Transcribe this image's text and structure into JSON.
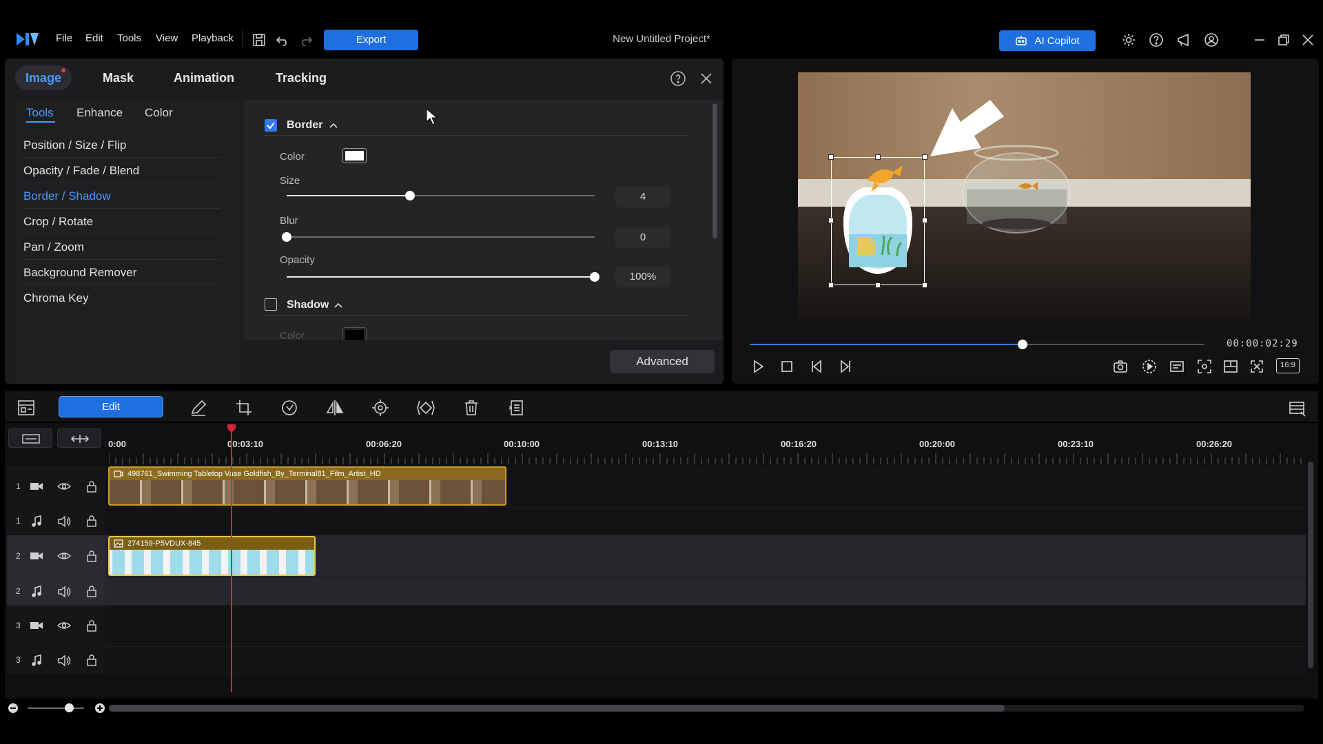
{
  "menubar": {
    "items": [
      "File",
      "Edit",
      "Tools",
      "View",
      "Playback"
    ],
    "export_label": "Export",
    "project_title": "New Untitled Project*",
    "copilot_label": "AI Copilot"
  },
  "panel": {
    "tabs": [
      "Image",
      "Mask",
      "Animation",
      "Tracking"
    ],
    "active_tab": "Image",
    "subtabs": [
      "Tools",
      "Enhance",
      "Color"
    ],
    "active_subtab": "Tools",
    "sidebar_items": [
      "Position / Size / Flip",
      "Opacity / Fade / Blend",
      "Border / Shadow",
      "Crop / Rotate",
      "Pan / Zoom",
      "Background Remover",
      "Chroma Key"
    ],
    "active_sidebar_item": "Border / Shadow",
    "border": {
      "title": "Border",
      "checked": true,
      "color_label": "Color",
      "color_value": "#ffffff",
      "size_label": "Size",
      "size_value": "4",
      "size_fraction": 0.4,
      "blur_label": "Blur",
      "blur_value": "0",
      "blur_fraction": 0.0,
      "opacity_label": "Opacity",
      "opacity_value": "100%",
      "opacity_fraction": 1.0
    },
    "shadow": {
      "title": "Shadow",
      "checked": false,
      "color_label": "Color",
      "color_value": "#000000"
    },
    "advanced_label": "Advanced"
  },
  "preview": {
    "timecode": "00:00:02:29",
    "progress_fraction": 0.6,
    "aspect_label": "16:9"
  },
  "timeline": {
    "edit_label": "Edit",
    "ticks": [
      "0:00",
      "00:03:10",
      "00:06:20",
      "00:10:00",
      "00:13:10",
      "00:16:20",
      "00:20:00",
      "00:23:10",
      "00:26:20"
    ],
    "tracks": [
      {
        "num": "1",
        "kind": "video"
      },
      {
        "num": "1",
        "kind": "audio"
      },
      {
        "num": "2",
        "kind": "video"
      },
      {
        "num": "2",
        "kind": "audio"
      },
      {
        "num": "3",
        "kind": "video"
      },
      {
        "num": "3",
        "kind": "audio"
      }
    ],
    "clip1_label": "498761_Swimming Tabletop Vase Goldfish_By_Terminal81_Film_Artist_HD",
    "clip2_label": "274159-P5VDUX-845"
  },
  "colors": {
    "accent": "#1f6fe0",
    "clip_border": "#c89a2a",
    "playhead": "#d9253c"
  }
}
